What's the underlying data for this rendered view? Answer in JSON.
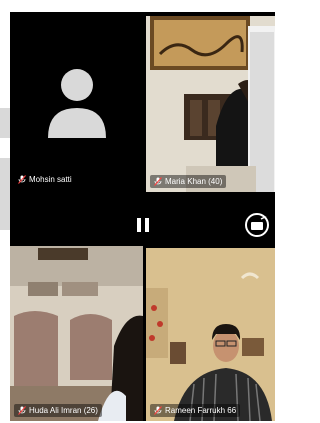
{
  "participants": [
    {
      "name": "Mohsin satti"
    },
    {
      "name": "Maria Khan (40)"
    },
    {
      "name": "Huda Ali Imran (26)"
    },
    {
      "name": "Rameen Farrukh 66"
    }
  ],
  "icons": {
    "avatar": "person-silhouette-icon",
    "mic": "mic-muted-icon",
    "pause": "pause-icon",
    "rotate": "rotate-camera-icon"
  },
  "colors": {
    "background": "#000000",
    "avatar": "#d9d9d9",
    "label_bg": "rgba(0,0,0,0.45)"
  }
}
